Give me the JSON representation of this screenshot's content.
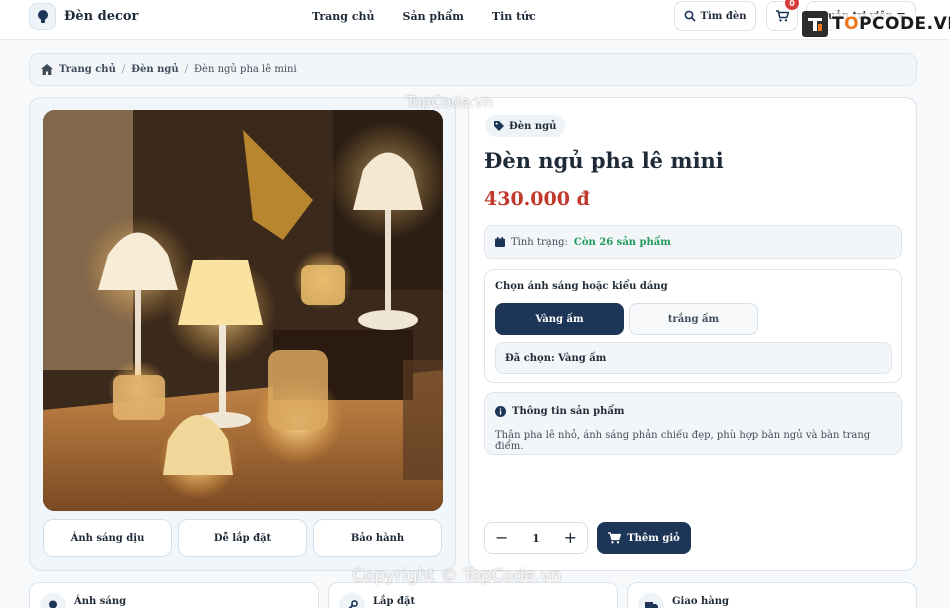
{
  "header": {
    "brand": "Đèn decor",
    "nav": [
      "Trang chủ",
      "Sản phẩm",
      "Tin tức"
    ],
    "search_label": "Tìm đèn",
    "cart_count": "0",
    "account_label": "Quản trị viên"
  },
  "breadcrumb": {
    "home": "Trang chủ",
    "category": "Đèn ngủ",
    "current": "Đèn ngủ pha lê mini",
    "separator": "/"
  },
  "gallery": {
    "features": [
      "Ánh sáng dịu",
      "Dễ lắp đặt",
      "Bảo hành"
    ]
  },
  "product": {
    "category": "Đèn ngủ",
    "title": "Đèn ngủ pha lê mini",
    "price": "430.000 đ",
    "stock_label": "Tình trạng:",
    "stock_value": "Còn 26 sản phẩm",
    "variant_title": "Chọn ánh sáng hoặc kiểu dáng",
    "variants": [
      "Vàng ấm",
      "trắng ấm"
    ],
    "selected_label": "Đã chọn: Vàng ấm",
    "info_title": "Thông tin sản phẩm",
    "info_desc": "Thân pha lê nhỏ, ánh sáng phản chiếu đẹp, phù hợp bàn ngủ và bàn trang điểm.",
    "quantity": "1",
    "add_to_cart": "Thêm giỏ"
  },
  "bottom_cards": [
    "Ánh sáng",
    "Lắp đặt",
    "Giao hàng"
  ],
  "watermarks": {
    "logo": "TOPCODE.VN",
    "top": "TopCode.vn",
    "bottom": "Copyright © TopCode.vn"
  },
  "colors": {
    "primary": "#1d3557",
    "price": "#c0392b",
    "stock": "#1e9a5a",
    "badge": "#d93a3a"
  }
}
